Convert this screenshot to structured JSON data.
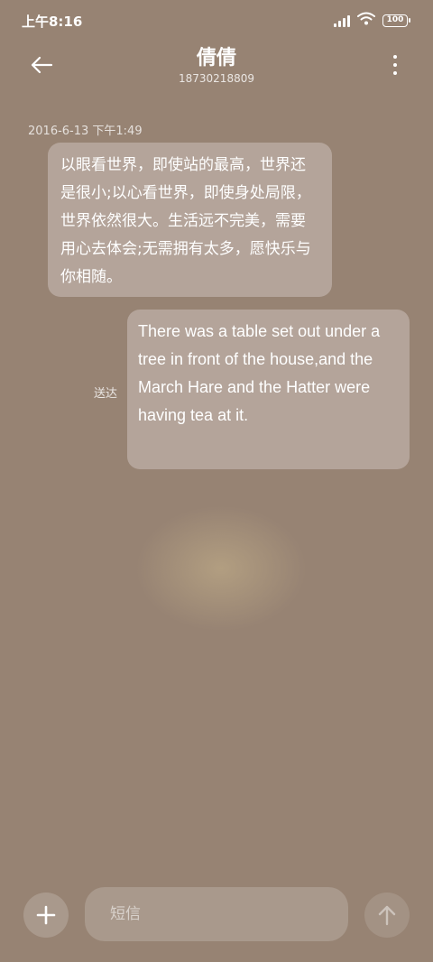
{
  "status_bar": {
    "time": "上午8:16",
    "battery": "100"
  },
  "header": {
    "contact_name": "倩倩",
    "contact_number": "18730218809"
  },
  "conversation": {
    "timestamp": "2016-6-13 下午1:49",
    "messages": [
      {
        "direction": "incoming",
        "text": "以眼看世界，即使站的最高，世界还是很小;以心看世界，即使身处局限，世界依然很大。生活远不完美，需要用心去体会;无需拥有太多，愿快乐与你相随。"
      },
      {
        "direction": "outgoing",
        "text": "There was a table set out under a tree in front of the house,and the March Hare and the Hatter were having tea at it.",
        "status": "送达"
      }
    ]
  },
  "composer": {
    "placeholder": "短信"
  },
  "colors": {
    "background": "#978373",
    "bubble": "#b4a49a"
  }
}
